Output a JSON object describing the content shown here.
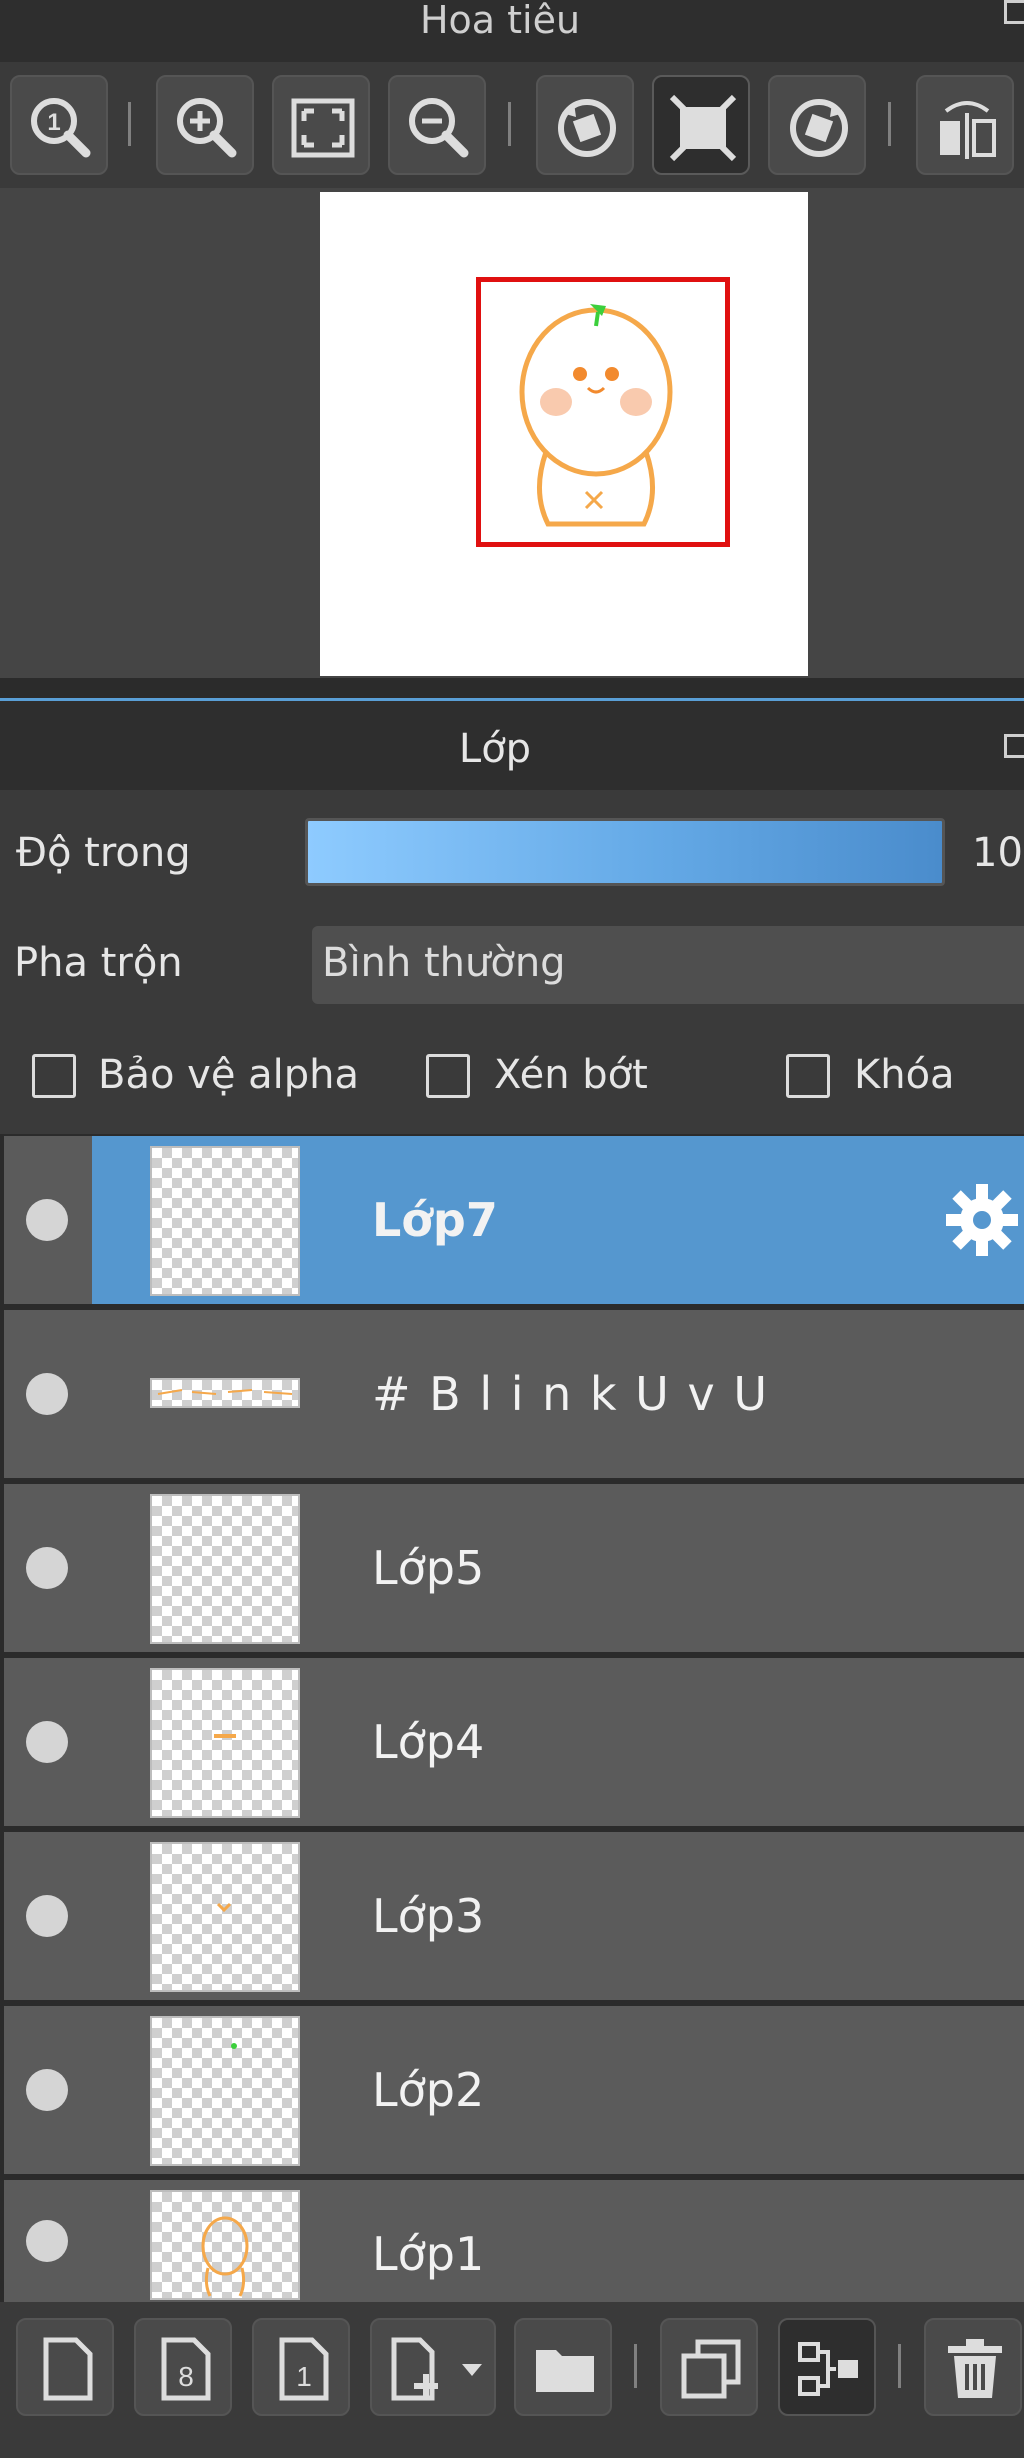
{
  "navigator": {
    "title": "Hoa tiêu",
    "toolbar": [
      {
        "name": "zoom-actual-button",
        "icon": "zoom-100-icon"
      },
      {
        "name": "zoom-in-button",
        "icon": "zoom-in-icon"
      },
      {
        "name": "fit-window-button",
        "icon": "fit-icon"
      },
      {
        "name": "zoom-out-button",
        "icon": "zoom-out-icon"
      },
      {
        "name": "rotate-left-button",
        "icon": "rotate-left-icon"
      },
      {
        "name": "reset-view-button",
        "icon": "reset-view-icon"
      },
      {
        "name": "rotate-right-button",
        "icon": "rotate-right-icon"
      },
      {
        "name": "flip-button",
        "icon": "flip-icon"
      }
    ]
  },
  "layers_panel": {
    "title": "Lớp",
    "opacity_label": "Độ trong",
    "opacity_value": "10",
    "opacity_fraction": 1.0,
    "blend_label": "Pha trộn",
    "blend_value": "Bình thường",
    "checkboxes": {
      "protect_alpha": "Bảo vệ alpha",
      "clipping": "Xén bớt",
      "lock": "Khóa"
    },
    "layers": [
      {
        "name": "Lớp7",
        "selected": true
      },
      {
        "name": "# B l i n k U v U",
        "selected": false
      },
      {
        "name": "Lớp5",
        "selected": false
      },
      {
        "name": "Lớp4",
        "selected": false
      },
      {
        "name": "Lớp3",
        "selected": false
      },
      {
        "name": "Lớp2",
        "selected": false
      },
      {
        "name": "Lớp1",
        "selected": false
      }
    ]
  },
  "colors": {
    "selected_layer": "#5597cf",
    "accent_line": "#5a9fd6",
    "viewport_frame": "#e01010",
    "character_stroke": "#f5a84a",
    "flag": "#3ccf3c"
  }
}
